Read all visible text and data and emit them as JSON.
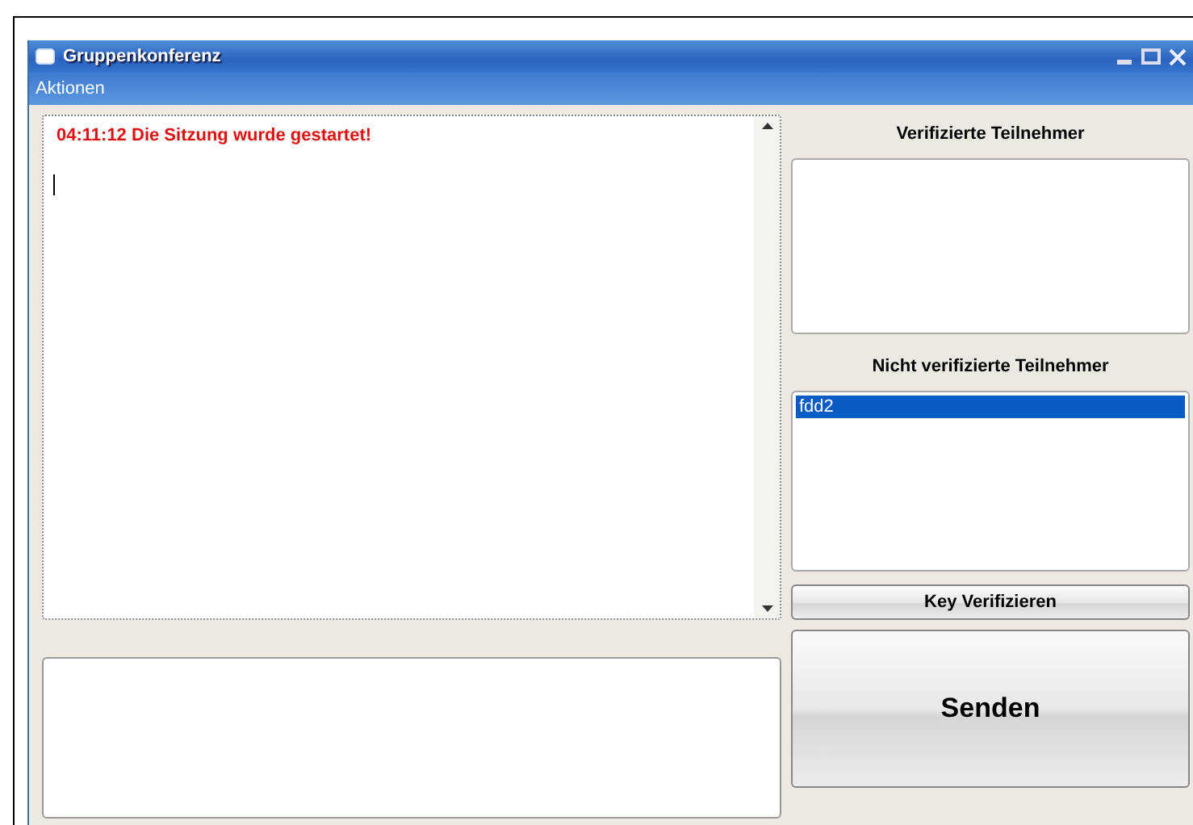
{
  "window": {
    "title": "Gruppenkonferenz"
  },
  "menu": [
    {
      "label": "Aktionen"
    }
  ],
  "chat": {
    "messages": [
      {
        "time": "04:11:12",
        "text": "Die Sitzung wurde gestartet!",
        "kind": "system"
      }
    ]
  },
  "verified": {
    "title": "Verifizierte Teilnehmer"
  },
  "unverified": {
    "title": "Nicht verifizierte Teilnehmer",
    "items": [
      {
        "name": "fdd2",
        "selected": true
      }
    ]
  },
  "buttons": {
    "verify": "Key Verifizieren",
    "send": "Senden"
  }
}
